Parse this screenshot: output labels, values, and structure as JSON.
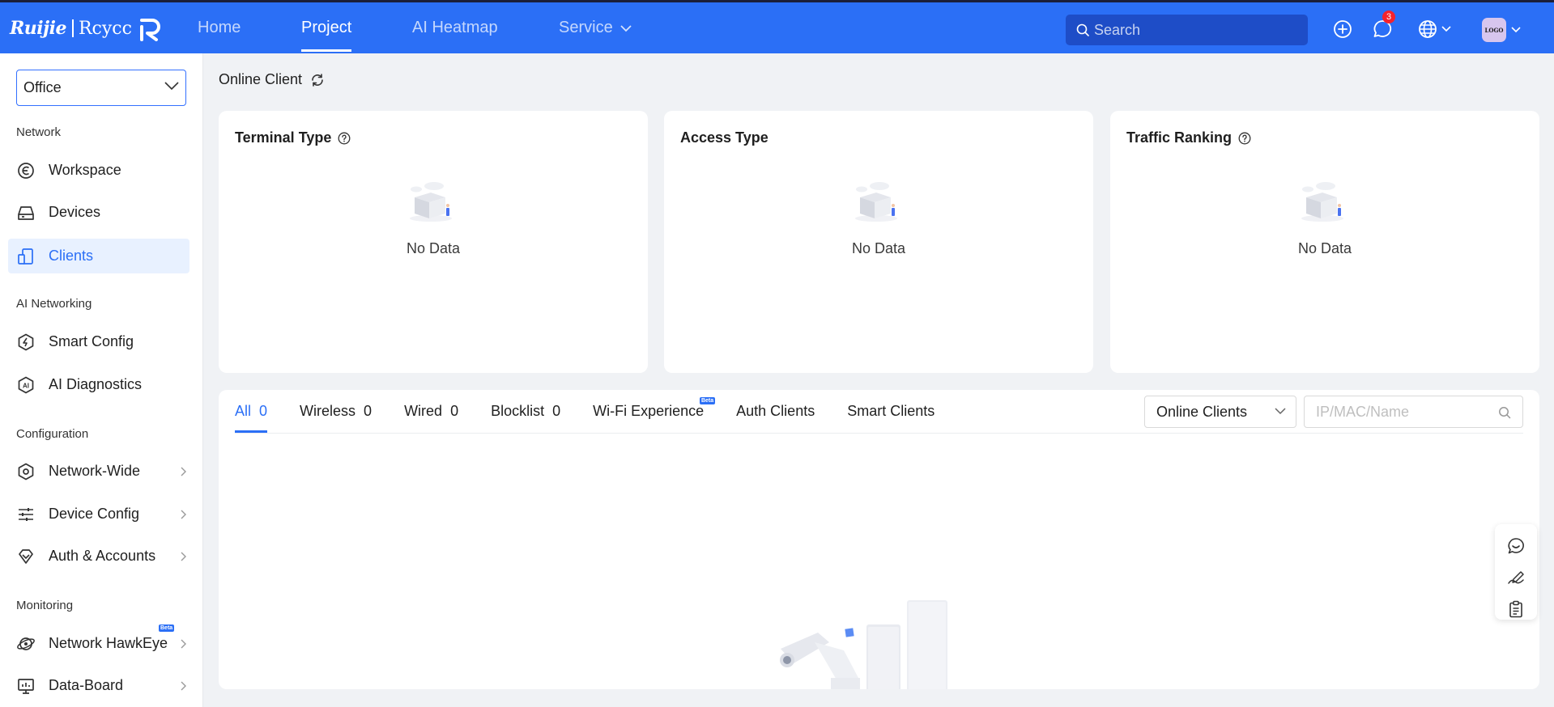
{
  "topbar": {
    "logo_brand": "Ruijie",
    "logo_product": "Rcycc",
    "nav": [
      {
        "label": "Home"
      },
      {
        "label": "Project"
      },
      {
        "label": "AI Heatmap"
      },
      {
        "label": "Service"
      }
    ],
    "search_placeholder": "Search",
    "message_count": "3",
    "avatar_text": "LOGO"
  },
  "sidebar": {
    "site": "Office",
    "sections": {
      "network": "Network",
      "ai_networking": "AI Networking",
      "configuration": "Configuration",
      "monitoring": "Monitoring"
    },
    "items": {
      "workspace": "Workspace",
      "devices": "Devices",
      "clients": "Clients",
      "smart_config": "Smart Config",
      "ai_diagnostics": "AI Diagnostics",
      "network_wide": "Network-Wide",
      "device_config": "Device Config",
      "auth_accounts": "Auth & Accounts",
      "network_hawkeye": "Network HawkEye",
      "data_board": "Data-Board"
    },
    "beta_label": "Beta",
    "active_color": "#2b6ff6"
  },
  "main": {
    "title": "Online Client",
    "cards": [
      {
        "title": "Terminal Type",
        "empty": "No Data"
      },
      {
        "title": "Access Type",
        "empty": "No Data"
      },
      {
        "title": "Traffic Ranking",
        "empty": "No Data"
      }
    ],
    "tabs": [
      {
        "label": "All",
        "count": "0"
      },
      {
        "label": "Wireless",
        "count": "0"
      },
      {
        "label": "Wired",
        "count": "0"
      },
      {
        "label": "Blocklist",
        "count": "0"
      },
      {
        "label": "Wi-Fi Experience",
        "count": ""
      },
      {
        "label": "Auth Clients",
        "count": ""
      },
      {
        "label": "Smart Clients",
        "count": ""
      }
    ],
    "tab_beta_label": "Beta",
    "filter_selected": "Online Clients",
    "filter_search_placeholder": "IP/MAC/Name"
  },
  "theme": {
    "topbar_color": "#2b6ff6",
    "accent": "#2b6ff6",
    "badge_color": "#f5222d"
  }
}
